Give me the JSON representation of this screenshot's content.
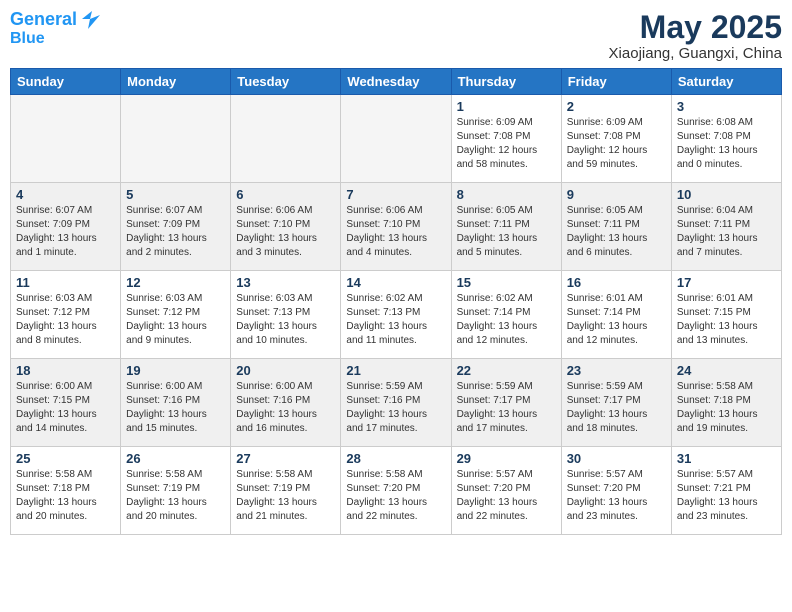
{
  "header": {
    "logo_line1": "General",
    "logo_line2": "Blue",
    "month_year": "May 2025",
    "location": "Xiaojiang, Guangxi, China"
  },
  "weekdays": [
    "Sunday",
    "Monday",
    "Tuesday",
    "Wednesday",
    "Thursday",
    "Friday",
    "Saturday"
  ],
  "weeks": [
    [
      {
        "day": "",
        "info": "",
        "empty": true
      },
      {
        "day": "",
        "info": "",
        "empty": true
      },
      {
        "day": "",
        "info": "",
        "empty": true
      },
      {
        "day": "",
        "info": "",
        "empty": true
      },
      {
        "day": "1",
        "info": "Sunrise: 6:09 AM\nSunset: 7:08 PM\nDaylight: 12 hours\nand 58 minutes."
      },
      {
        "day": "2",
        "info": "Sunrise: 6:09 AM\nSunset: 7:08 PM\nDaylight: 12 hours\nand 59 minutes."
      },
      {
        "day": "3",
        "info": "Sunrise: 6:08 AM\nSunset: 7:08 PM\nDaylight: 13 hours\nand 0 minutes."
      }
    ],
    [
      {
        "day": "4",
        "info": "Sunrise: 6:07 AM\nSunset: 7:09 PM\nDaylight: 13 hours\nand 1 minute."
      },
      {
        "day": "5",
        "info": "Sunrise: 6:07 AM\nSunset: 7:09 PM\nDaylight: 13 hours\nand 2 minutes."
      },
      {
        "day": "6",
        "info": "Sunrise: 6:06 AM\nSunset: 7:10 PM\nDaylight: 13 hours\nand 3 minutes."
      },
      {
        "day": "7",
        "info": "Sunrise: 6:06 AM\nSunset: 7:10 PM\nDaylight: 13 hours\nand 4 minutes."
      },
      {
        "day": "8",
        "info": "Sunrise: 6:05 AM\nSunset: 7:11 PM\nDaylight: 13 hours\nand 5 minutes."
      },
      {
        "day": "9",
        "info": "Sunrise: 6:05 AM\nSunset: 7:11 PM\nDaylight: 13 hours\nand 6 minutes."
      },
      {
        "day": "10",
        "info": "Sunrise: 6:04 AM\nSunset: 7:11 PM\nDaylight: 13 hours\nand 7 minutes."
      }
    ],
    [
      {
        "day": "11",
        "info": "Sunrise: 6:03 AM\nSunset: 7:12 PM\nDaylight: 13 hours\nand 8 minutes."
      },
      {
        "day": "12",
        "info": "Sunrise: 6:03 AM\nSunset: 7:12 PM\nDaylight: 13 hours\nand 9 minutes."
      },
      {
        "day": "13",
        "info": "Sunrise: 6:03 AM\nSunset: 7:13 PM\nDaylight: 13 hours\nand 10 minutes."
      },
      {
        "day": "14",
        "info": "Sunrise: 6:02 AM\nSunset: 7:13 PM\nDaylight: 13 hours\nand 11 minutes."
      },
      {
        "day": "15",
        "info": "Sunrise: 6:02 AM\nSunset: 7:14 PM\nDaylight: 13 hours\nand 12 minutes."
      },
      {
        "day": "16",
        "info": "Sunrise: 6:01 AM\nSunset: 7:14 PM\nDaylight: 13 hours\nand 12 minutes."
      },
      {
        "day": "17",
        "info": "Sunrise: 6:01 AM\nSunset: 7:15 PM\nDaylight: 13 hours\nand 13 minutes."
      }
    ],
    [
      {
        "day": "18",
        "info": "Sunrise: 6:00 AM\nSunset: 7:15 PM\nDaylight: 13 hours\nand 14 minutes."
      },
      {
        "day": "19",
        "info": "Sunrise: 6:00 AM\nSunset: 7:16 PM\nDaylight: 13 hours\nand 15 minutes."
      },
      {
        "day": "20",
        "info": "Sunrise: 6:00 AM\nSunset: 7:16 PM\nDaylight: 13 hours\nand 16 minutes."
      },
      {
        "day": "21",
        "info": "Sunrise: 5:59 AM\nSunset: 7:16 PM\nDaylight: 13 hours\nand 17 minutes."
      },
      {
        "day": "22",
        "info": "Sunrise: 5:59 AM\nSunset: 7:17 PM\nDaylight: 13 hours\nand 17 minutes."
      },
      {
        "day": "23",
        "info": "Sunrise: 5:59 AM\nSunset: 7:17 PM\nDaylight: 13 hours\nand 18 minutes."
      },
      {
        "day": "24",
        "info": "Sunrise: 5:58 AM\nSunset: 7:18 PM\nDaylight: 13 hours\nand 19 minutes."
      }
    ],
    [
      {
        "day": "25",
        "info": "Sunrise: 5:58 AM\nSunset: 7:18 PM\nDaylight: 13 hours\nand 20 minutes."
      },
      {
        "day": "26",
        "info": "Sunrise: 5:58 AM\nSunset: 7:19 PM\nDaylight: 13 hours\nand 20 minutes."
      },
      {
        "day": "27",
        "info": "Sunrise: 5:58 AM\nSunset: 7:19 PM\nDaylight: 13 hours\nand 21 minutes."
      },
      {
        "day": "28",
        "info": "Sunrise: 5:58 AM\nSunset: 7:20 PM\nDaylight: 13 hours\nand 22 minutes."
      },
      {
        "day": "29",
        "info": "Sunrise: 5:57 AM\nSunset: 7:20 PM\nDaylight: 13 hours\nand 22 minutes."
      },
      {
        "day": "30",
        "info": "Sunrise: 5:57 AM\nSunset: 7:20 PM\nDaylight: 13 hours\nand 23 minutes."
      },
      {
        "day": "31",
        "info": "Sunrise: 5:57 AM\nSunset: 7:21 PM\nDaylight: 13 hours\nand 23 minutes."
      }
    ]
  ]
}
